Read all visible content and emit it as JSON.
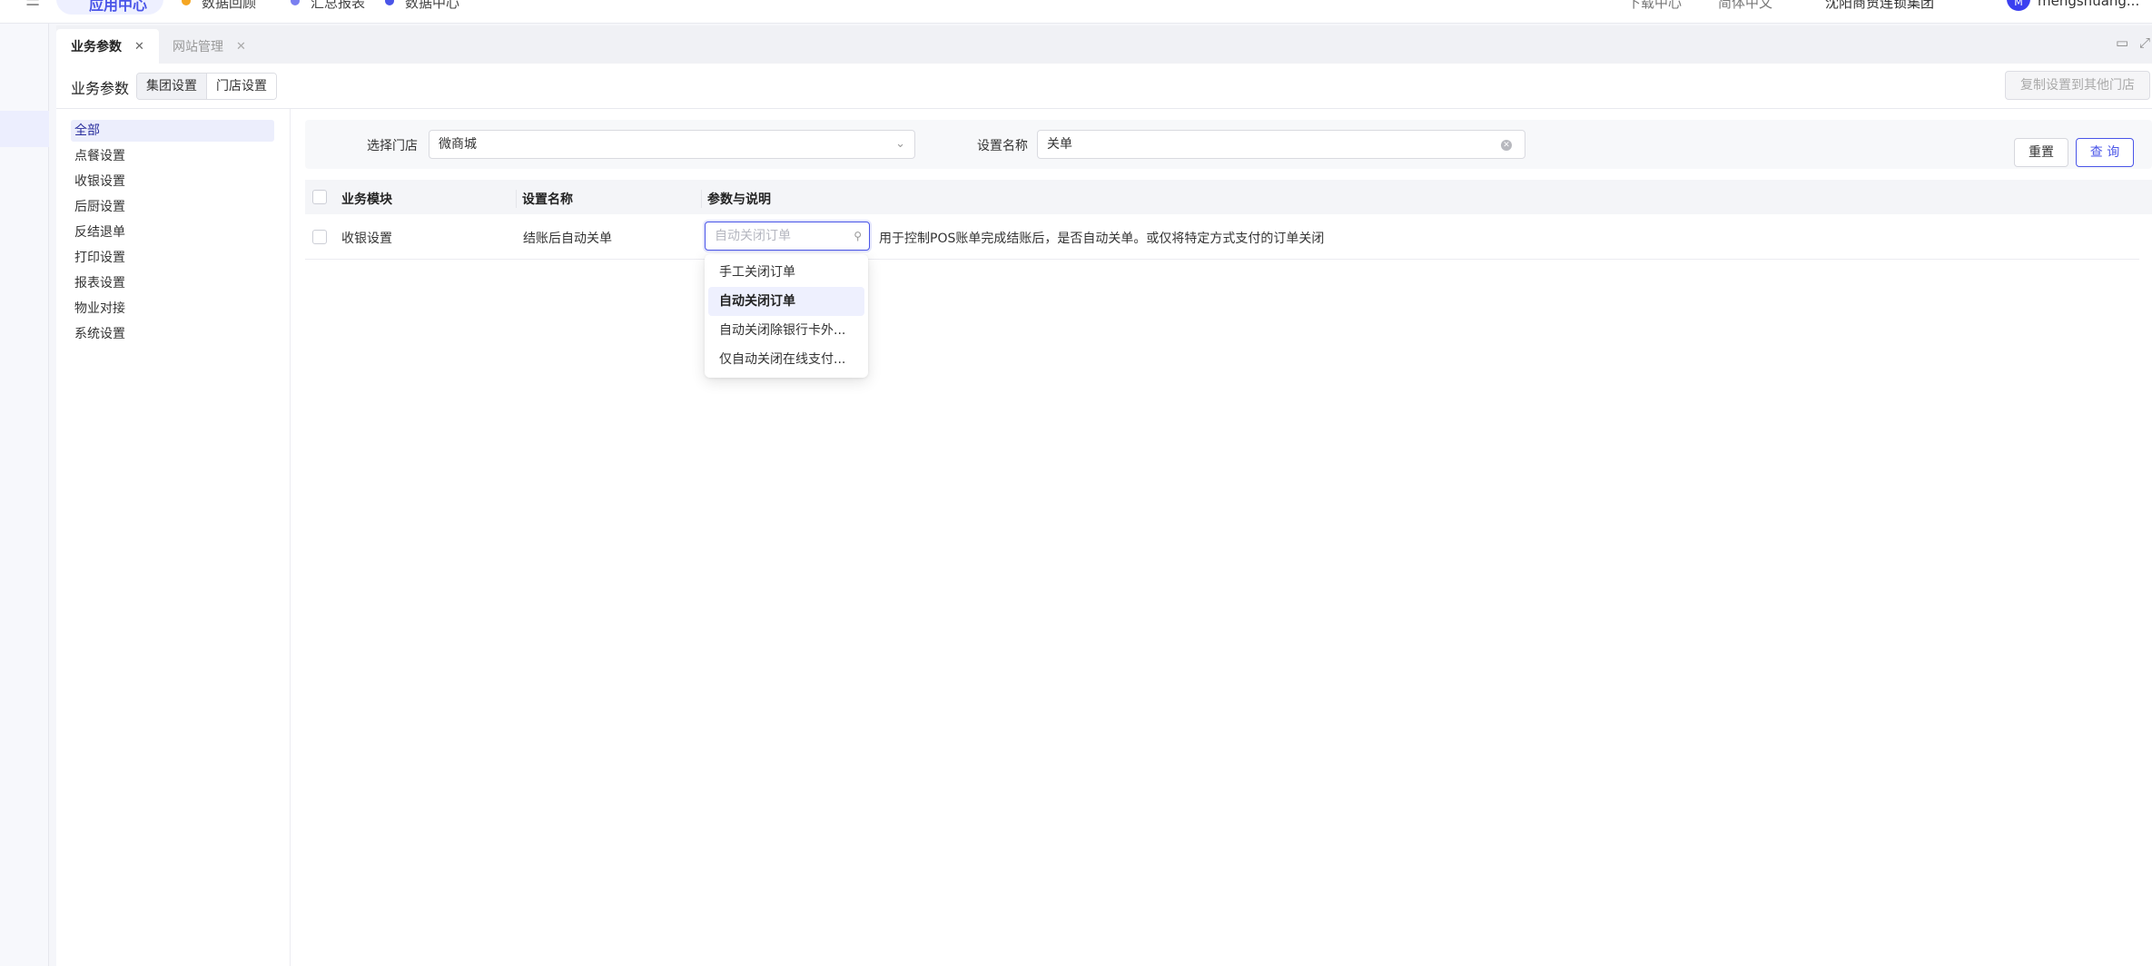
{
  "topbar": {
    "active_pill": "应用中心",
    "links": [
      "数据回顾",
      "汇总报表",
      "数据中心"
    ],
    "right_items": [
      "下载中心",
      "简体中文",
      "沈阳商贸连锁集团"
    ],
    "avatar_initials": "M",
    "user_name": "mengshuang..."
  },
  "tabs": [
    {
      "label": "业务参数",
      "active": true,
      "close": "✕"
    },
    {
      "label": "网站管理",
      "active": false,
      "close": "✕"
    }
  ],
  "tabstrip_icons": [
    "lock-icon",
    "fullscreen-icon"
  ],
  "header": {
    "title": "业务参数",
    "scope_options": [
      "集团设置",
      "门店设置"
    ],
    "copy_button": "复制设置到其他门店"
  },
  "categories": [
    "全部",
    "点餐设置",
    "收银设置",
    "后厨设置",
    "反结退单",
    "打印设置",
    "报表设置",
    "物业对接",
    "系统设置"
  ],
  "filter": {
    "store_label": "选择门店",
    "store_value": "微商城",
    "name_label": "设置名称",
    "name_value": "关单",
    "reset": "重置",
    "query": "查 询"
  },
  "table": {
    "columns": [
      "业务模块",
      "设置名称",
      "参数与说明"
    ],
    "rows": [
      {
        "module": "收银设置",
        "name": "结账后自动关单",
        "select_placeholder": "自动关闭订单",
        "description": "用于控制POS账单完成结账后，是否自动关单。或仅将特定方式支付的订单关闭"
      }
    ]
  },
  "dropdown": {
    "options": [
      "手工关闭订单",
      "自动关闭订单",
      "自动关闭除银行卡外...",
      "仅自动关闭在线支付..."
    ],
    "selected_index": 1
  },
  "colors": {
    "accent": "#4a55e8",
    "selected_bg": "#eef0fe"
  }
}
